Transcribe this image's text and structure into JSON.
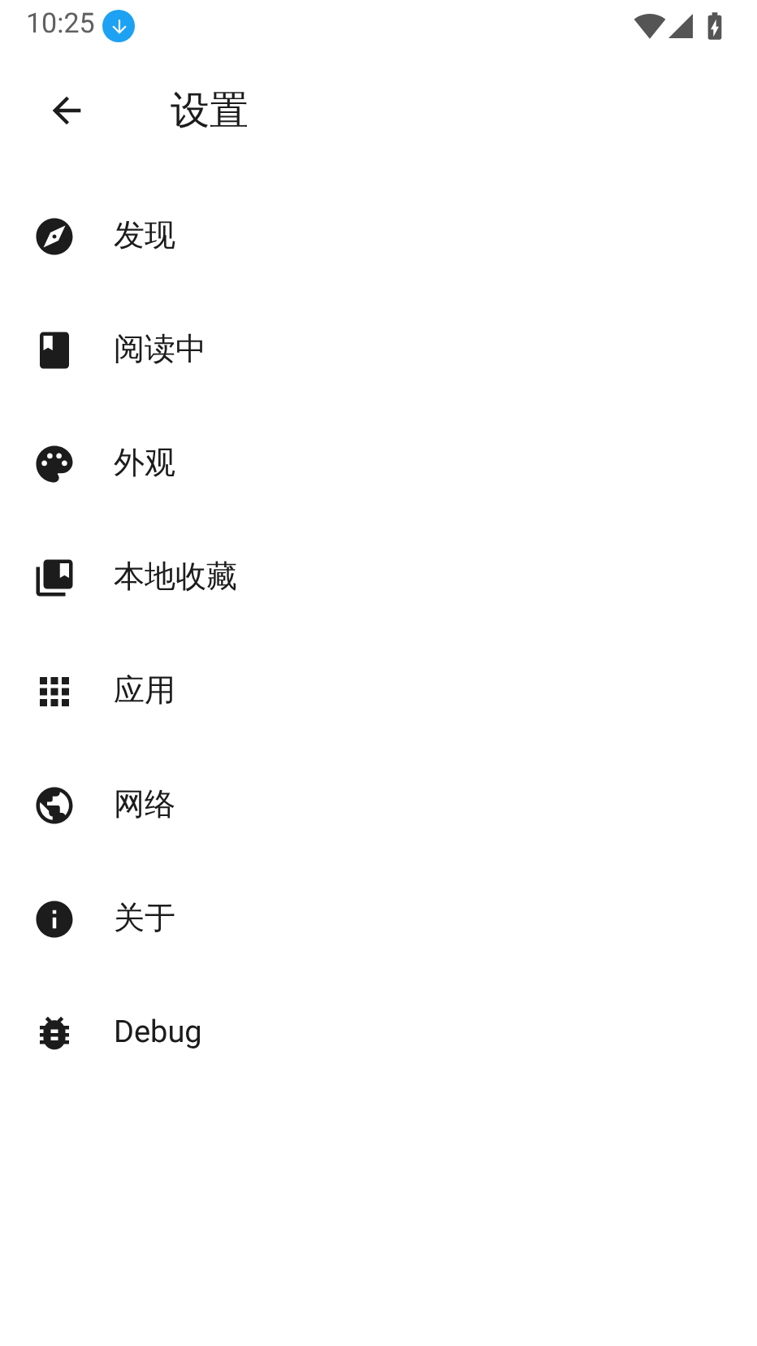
{
  "status_bar": {
    "time": "10:25"
  },
  "header": {
    "title": "设置"
  },
  "items": [
    {
      "kind": "explore",
      "label": "发现"
    },
    {
      "kind": "book",
      "label": "阅读中"
    },
    {
      "kind": "palette",
      "label": "外观"
    },
    {
      "kind": "collection",
      "label": "本地收藏"
    },
    {
      "kind": "apps",
      "label": "应用"
    },
    {
      "kind": "globe",
      "label": "网络"
    },
    {
      "kind": "info",
      "label": "关于"
    },
    {
      "kind": "bug",
      "label": "Debug"
    }
  ]
}
